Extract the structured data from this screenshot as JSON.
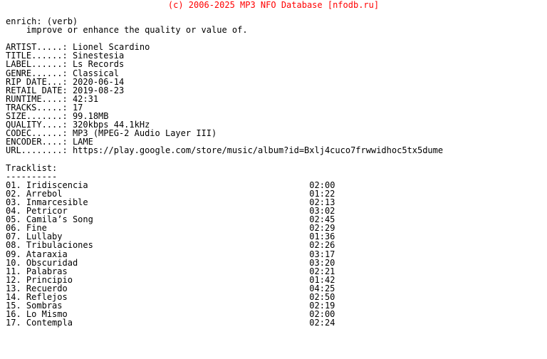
{
  "header": {
    "copyright": "(c) 2006-2025 MP3 NFO Database [nfodb.ru]",
    "color": "#ff0000"
  },
  "definition": {
    "term": "enrich: (verb)",
    "meaning": "improve or enhance the quality or value of."
  },
  "metadata": {
    "rows": [
      {
        "label": "ARTIST.....:",
        "value": "Lionel Scardino"
      },
      {
        "label": "TITLE......:",
        "value": "Sinestesia"
      },
      {
        "label": "LABEL......:",
        "value": "Ls Records"
      },
      {
        "label": "GENRE......:",
        "value": "Classical"
      },
      {
        "label": "RIP DATE...:",
        "value": "2020-06-14"
      },
      {
        "label": "RETAIL DATE:",
        "value": "2019-08-23"
      },
      {
        "label": "RUNTIME....:",
        "value": "42:31"
      },
      {
        "label": "TRACKS.....:",
        "value": "17"
      },
      {
        "label": "SIZE.......:",
        "value": "99.18MB"
      },
      {
        "label": "QUALITY....:",
        "value": "320kbps 44.1kHz"
      },
      {
        "label": "CODEC......:",
        "value": "MP3 (MPEG-2 Audio Layer III)"
      },
      {
        "label": "ENCODER....:",
        "value": "LAME"
      },
      {
        "label": "URL........:",
        "value": "https://play.google.com/store/music/album?id=Bxlj4cuco7frwwidhoc5tx5dume"
      }
    ]
  },
  "tracklist": {
    "heading": "Tracklist:",
    "underline": "----------",
    "tracks": [
      {
        "num": "01.",
        "title": "Iridiscencia",
        "time": "02:00"
      },
      {
        "num": "02.",
        "title": "Arrebol",
        "time": "01:22"
      },
      {
        "num": "03.",
        "title": "Inmarcesible",
        "time": "02:13"
      },
      {
        "num": "04.",
        "title": "Petricor",
        "time": "03:02"
      },
      {
        "num": "05.",
        "title": "Camila’s Song",
        "time": "02:45"
      },
      {
        "num": "06.",
        "title": "Fine",
        "time": "02:29"
      },
      {
        "num": "07.",
        "title": "Lullaby",
        "time": "01:36"
      },
      {
        "num": "08.",
        "title": "Tribulaciones",
        "time": "02:26"
      },
      {
        "num": "09.",
        "title": "Ataraxia",
        "time": "03:17"
      },
      {
        "num": "10.",
        "title": "Obscuridad",
        "time": "03:20"
      },
      {
        "num": "11.",
        "title": "Palabras",
        "time": "02:21"
      },
      {
        "num": "12.",
        "title": "Principio",
        "time": "01:42"
      },
      {
        "num": "13.",
        "title": "Recuerdo",
        "time": "04:25"
      },
      {
        "num": "14.",
        "title": "Reflejos",
        "time": "02:50"
      },
      {
        "num": "15.",
        "title": "Sombras",
        "time": "02:19"
      },
      {
        "num": "16.",
        "title": "Lo Mismo",
        "time": "02:00"
      },
      {
        "num": "17.",
        "title": "Contempla",
        "time": "02:24"
      }
    ]
  }
}
